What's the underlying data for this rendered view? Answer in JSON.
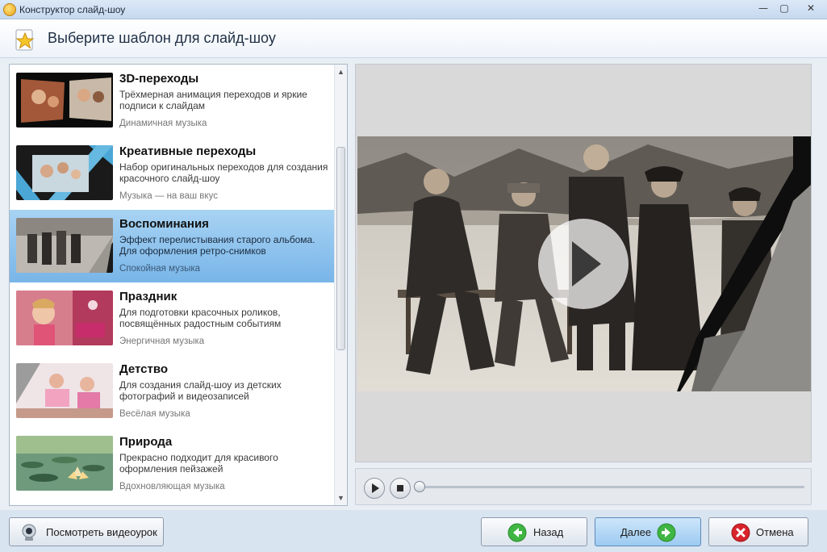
{
  "window": {
    "title": "Конструктор слайд-шоу",
    "controls": {
      "minimize": "—",
      "maximize": "▢",
      "close": "✕"
    }
  },
  "header": {
    "title": "Выберите шаблон для слайд-шоу",
    "icon": "star-icon"
  },
  "templates": [
    {
      "title": "3D-переходы",
      "description": "Трёхмерная анимация переходов и яркие подписи к слайдам",
      "music": "Динамичная музыка",
      "selected": false
    },
    {
      "title": "Креативные переходы",
      "description": "Набор оригинальных переходов для создания красочного слайд-шоу",
      "music": "Музыка — на ваш вкус",
      "selected": false
    },
    {
      "title": "Воспоминания",
      "description": "Эффект перелистывания старого альбома. Для оформления ретро-снимков",
      "music": "Спокойная музыка",
      "selected": true
    },
    {
      "title": "Праздник",
      "description": "Для подготовки красочных роликов, посвящённых радостным событиям",
      "music": "Энергичная музыка",
      "selected": false
    },
    {
      "title": "Детство",
      "description": "Для создания слайд-шоу из детских фотографий и видеозаписей",
      "music": "Весёлая музыка",
      "selected": false
    },
    {
      "title": "Природа",
      "description": "Прекрасно подходит для красивого оформления пейзажей",
      "music": "Вдохновляющая музыка",
      "selected": false
    }
  ],
  "player": {
    "progress": 0,
    "icons": {
      "play": "play-icon",
      "stop": "stop-icon"
    }
  },
  "footer": {
    "tutorial_label": "Посмотреть видеоурок",
    "back_label": "Назад",
    "next_label": "Далее",
    "cancel_label": "Отмена"
  },
  "colors": {
    "selection": "#78b5e8",
    "back_icon": "#3fb542",
    "next_icon": "#3fb542",
    "cancel_icon": "#d8242b"
  }
}
